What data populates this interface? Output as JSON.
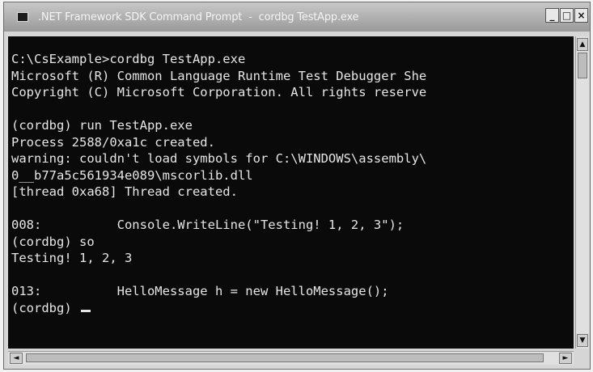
{
  "window": {
    "title": ".NET Framework SDK Command Prompt",
    "subtitle": "cordbg TestApp.exe",
    "controls": {
      "minimize": "_",
      "maximize": "□",
      "close": "×"
    }
  },
  "console": {
    "lines": [
      "C:\\CsExample>cordbg TestApp.exe",
      "Microsoft (R) Common Language Runtime Test Debugger She",
      "Copyright (C) Microsoft Corporation. All rights reserve",
      "",
      "(cordbg) run TestApp.exe",
      "Process 2588/0xa1c created.",
      "warning: couldn't load symbols for C:\\WINDOWS\\assembly\\",
      "0__b77a5c561934e089\\mscorlib.dll",
      "[thread 0xa68] Thread created.",
      "",
      "008:          Console.WriteLine(\"Testing! 1, 2, 3\");",
      "(cordbg) so",
      "Testing! 1, 2, 3",
      "",
      "013:          HelloMessage h = new HelloMessage();",
      "(cordbg) "
    ]
  },
  "scrollbars": {
    "vertical": {
      "up": "▲",
      "down": "▼"
    },
    "horizontal": {
      "left": "◄",
      "right": "►"
    }
  }
}
